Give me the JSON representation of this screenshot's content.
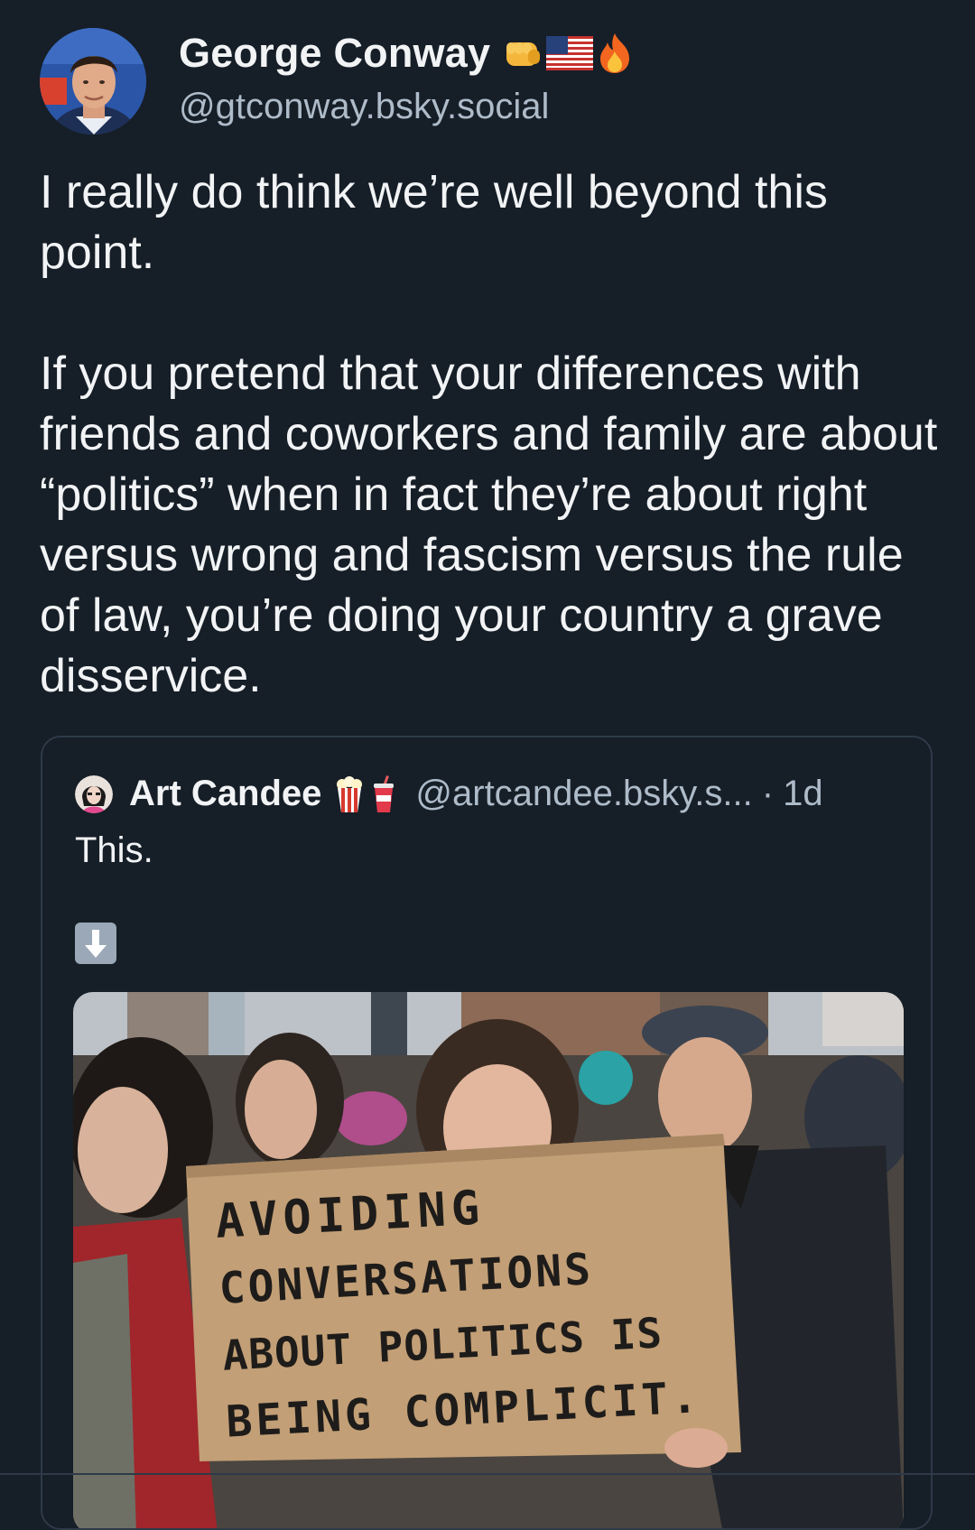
{
  "post": {
    "author": {
      "name": "George Conway",
      "handle": "@gtconway.bsky.social",
      "name_emojis": [
        "fist-icon",
        "us-flag-icon",
        "fire-icon"
      ]
    },
    "text_paragraphs": [
      "I really do think we’re well beyond this point.",
      "If you pretend that your differences with friends and coworkers and family are about “politics” when in fact they’re about right versus wrong and fascism versus the rule of law, you’re doing your country a grave disservice."
    ]
  },
  "quote": {
    "author": {
      "name": "Art Candee",
      "handle": "@artcandee.bsky.s...",
      "name_emojis": [
        "popcorn-icon",
        "soda-cup-icon"
      ]
    },
    "separator": "·",
    "time": "1d",
    "text": "This.",
    "arrow_icon": "down-arrow-icon",
    "image_sign_lines": [
      "AVOIDING",
      "CONVERSATIONS",
      "ABOUT POLITICS IS",
      "BEING COMPLICIT."
    ]
  },
  "colors": {
    "background": "#161e27",
    "text": "#f1f3f5",
    "muted": "#aebbc9",
    "border": "#2e3a48"
  }
}
